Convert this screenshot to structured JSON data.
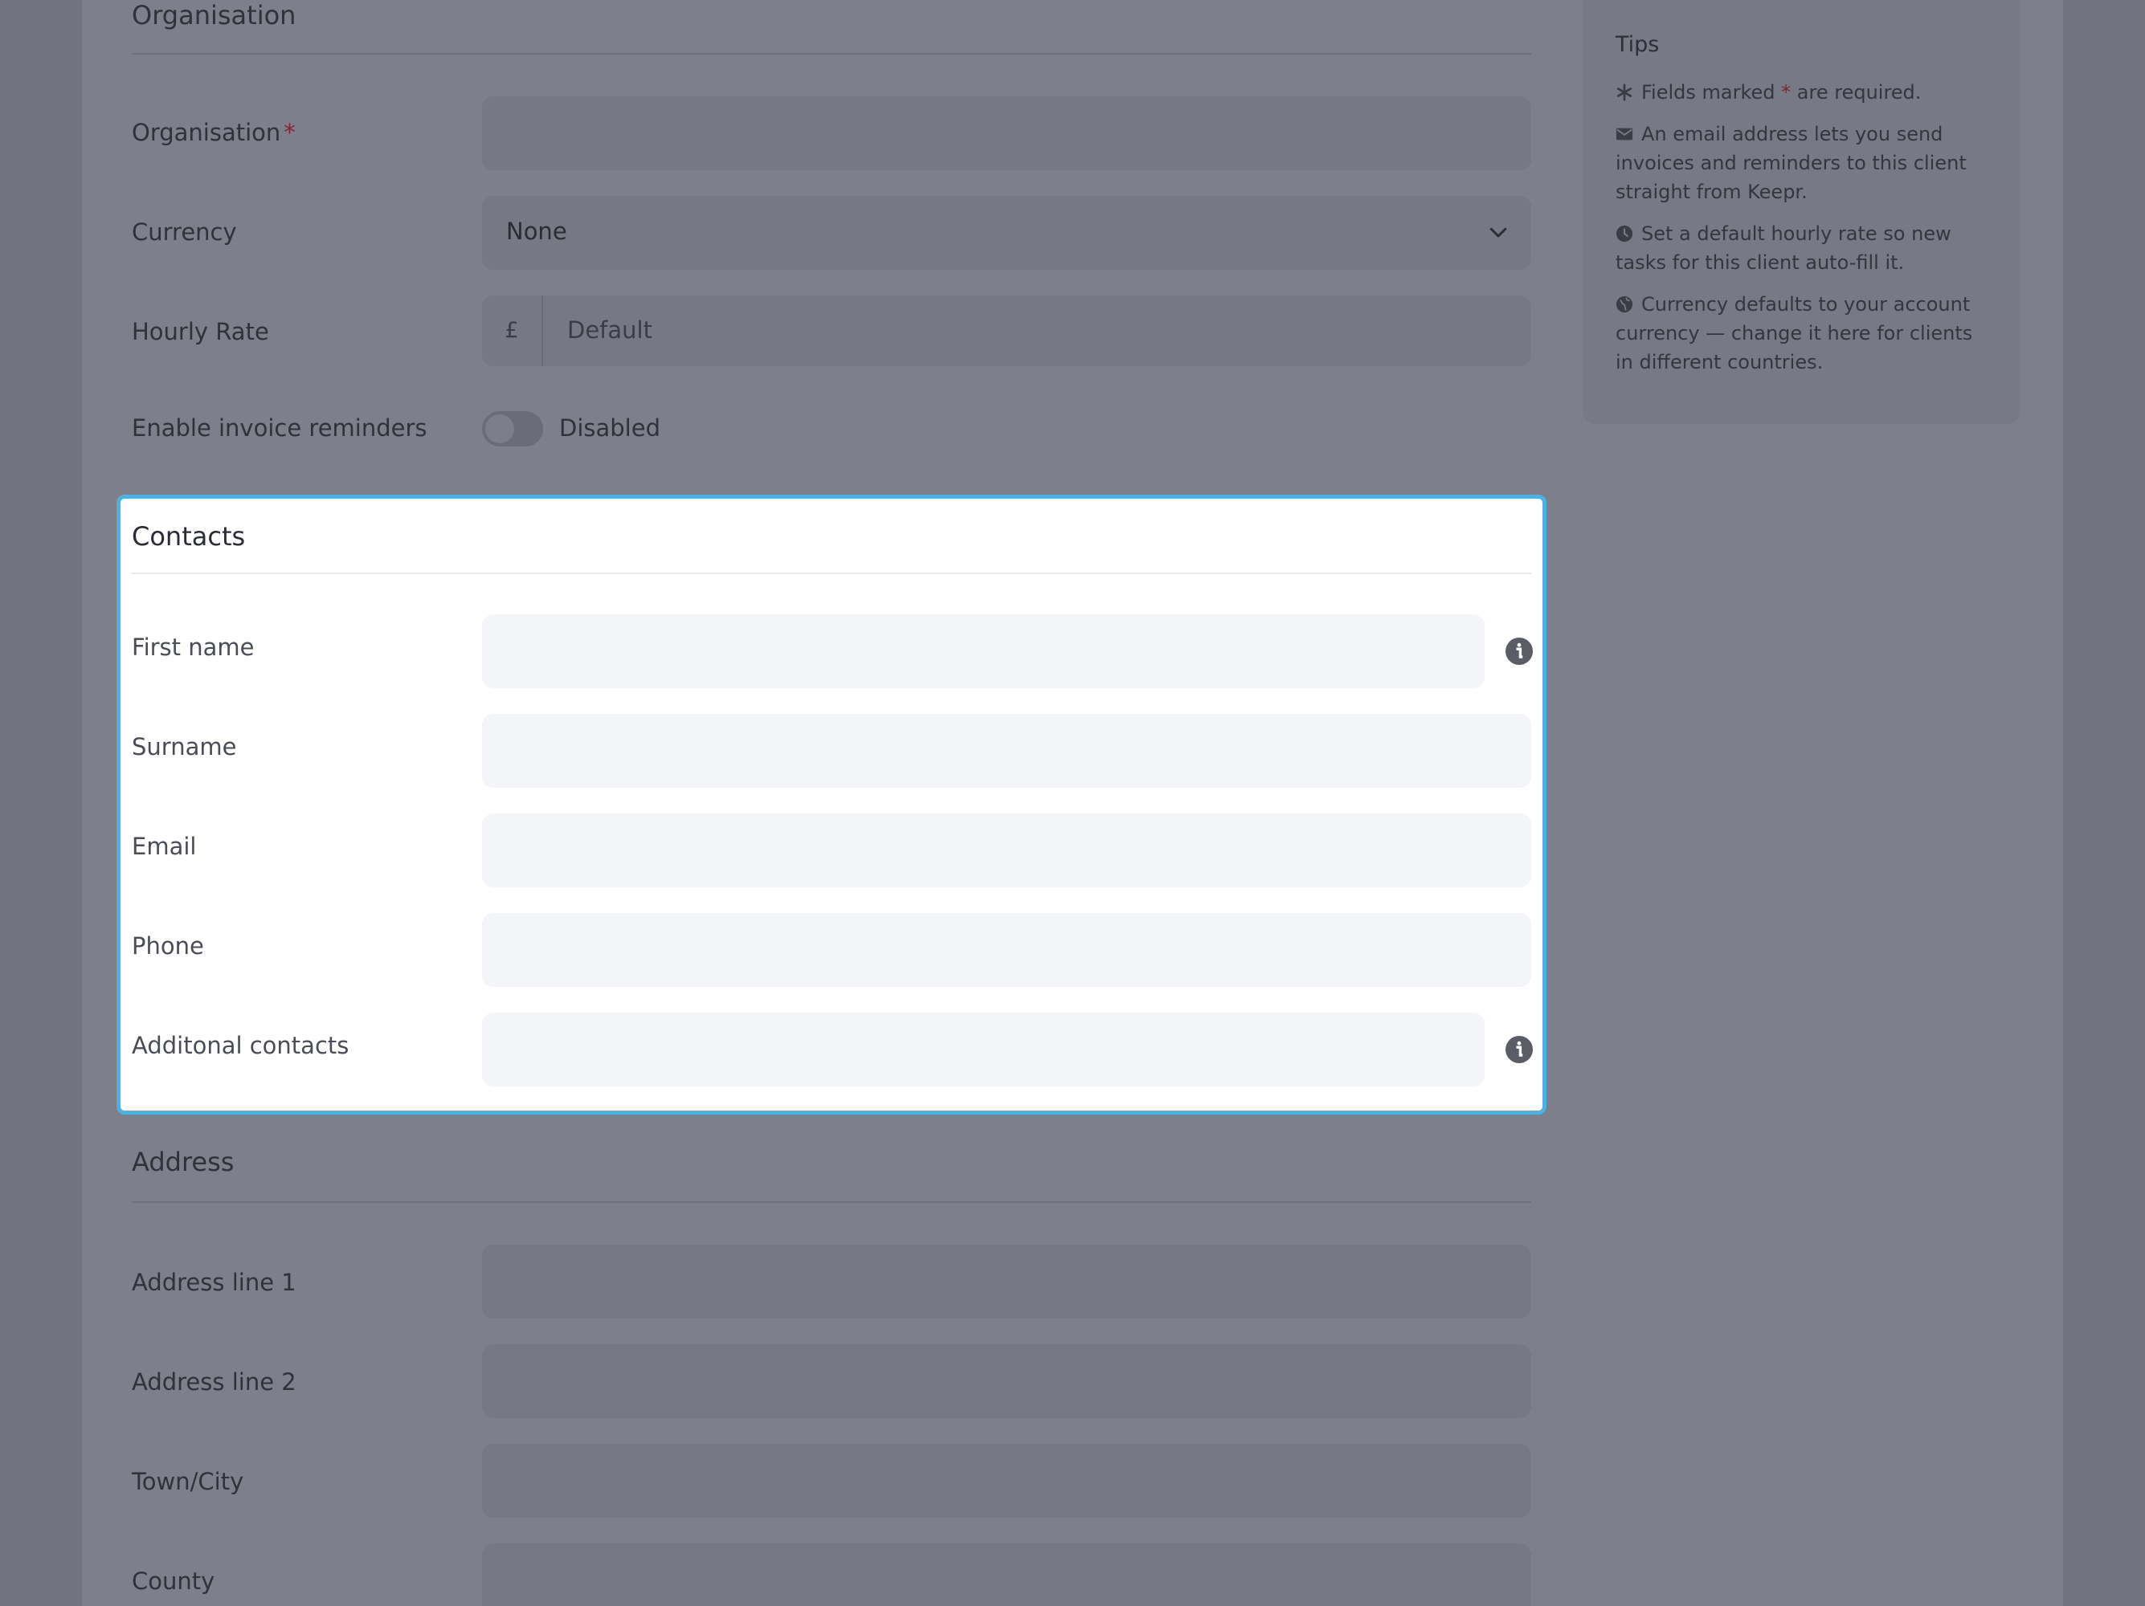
{
  "organisation_section": {
    "title": "Organisation",
    "organisation_label": "Organisation",
    "required_mark": "*",
    "currency_label": "Currency",
    "currency_value": "None",
    "hourly_rate_label": "Hourly Rate",
    "hourly_rate_prefix": "£",
    "hourly_rate_placeholder": "Default",
    "reminders_label": "Enable invoice reminders",
    "reminders_state": "Disabled"
  },
  "tips": {
    "title": "Tips",
    "items": [
      {
        "icon": "asterisk-icon",
        "pre": "Fields marked ",
        "mark": "*",
        "post": " are required."
      },
      {
        "icon": "envelope-icon",
        "text": "An email address lets you send invoices and reminders to this client straight from Keepr."
      },
      {
        "icon": "clock-icon",
        "text": "Set a default hourly rate so new tasks for this client auto-fill it."
      },
      {
        "icon": "globe-icon",
        "text": "Currency defaults to your account currency — change it here for clients in different countries."
      }
    ]
  },
  "contacts": {
    "title": "Contacts",
    "first_name_label": "First name",
    "surname_label": "Surname",
    "email_label": "Email",
    "phone_label": "Phone",
    "additional_label": "Additonal contacts"
  },
  "address": {
    "title": "Address",
    "line1_label": "Address line 1",
    "line2_label": "Address line 2",
    "town_label": "Town/City",
    "county_label": "County"
  },
  "colors": {
    "accent": "#4fb1e0",
    "required": "#7a2a36",
    "overlay": "#717380"
  }
}
